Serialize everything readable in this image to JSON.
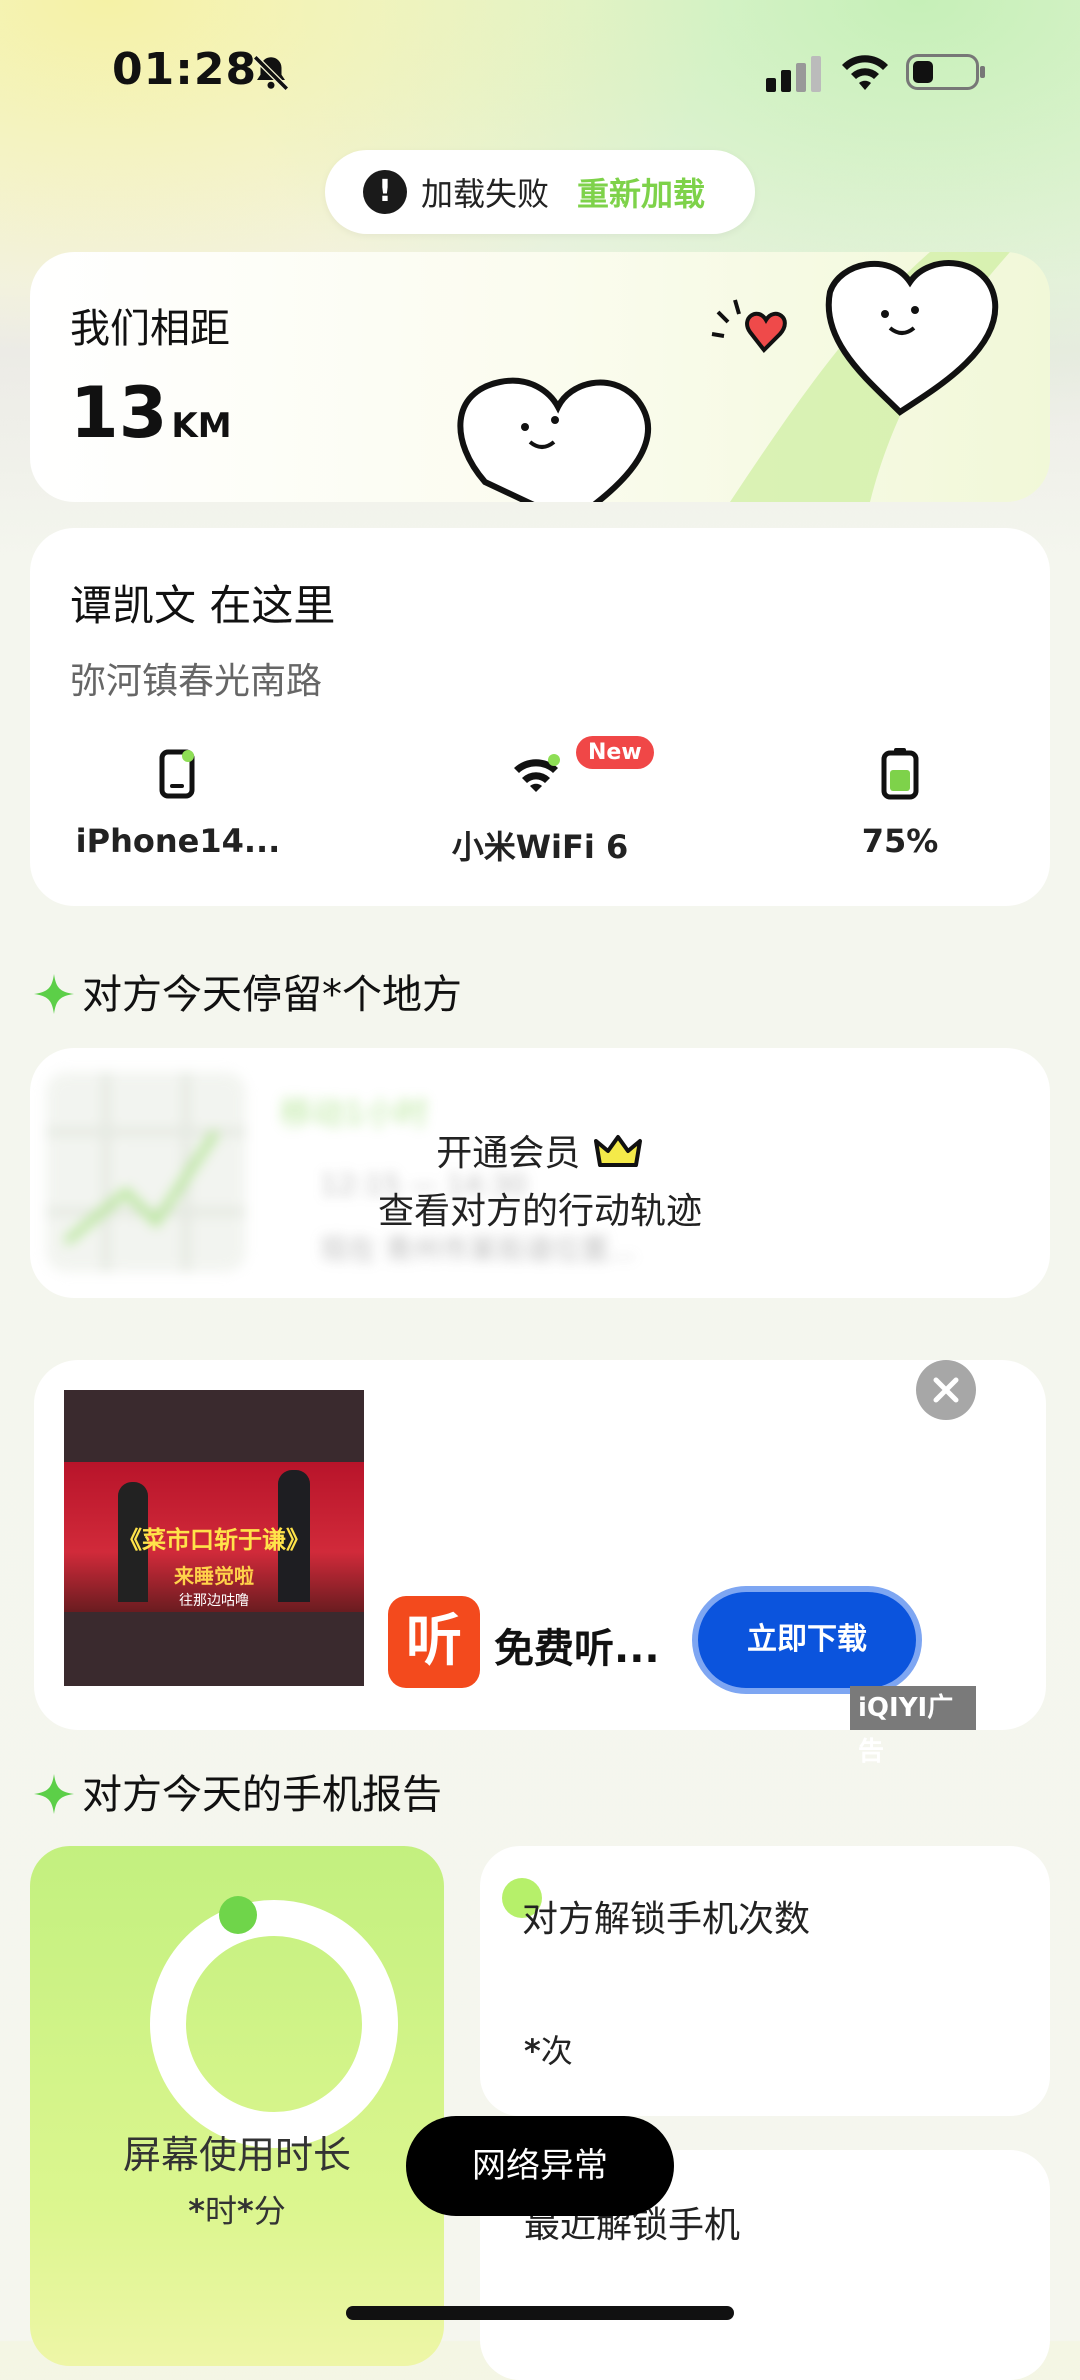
{
  "status_bar": {
    "time": "01:28"
  },
  "load_notice": {
    "message": "加载失败",
    "action": "重新加载"
  },
  "distance": {
    "title": "我们相距",
    "value": "13",
    "unit": "KM"
  },
  "location": {
    "person": "谭凯文 在这里",
    "address": "弥河镇春光南路",
    "device": "iPhone14...",
    "wifi": "小米WiFi 6",
    "wifi_badge": "New",
    "battery": "75%"
  },
  "stay_section": {
    "title": "对方今天停留*个地方"
  },
  "membership": {
    "line1": "开通会员",
    "line2": "查看对方的行动轨迹",
    "blur_title": "移动1小时",
    "blur_row1": "12:15 — 14:30",
    "blur_row2": "现在    青州市某街道位置..."
  },
  "ad": {
    "thumb_title": "《菜市口斩于谦》",
    "thumb_sub": "来睡觉啦",
    "thumb_caption": "往那边咕噜",
    "app_logo": "听",
    "text": "免费听...",
    "button": "立即下载",
    "mark": "iQIYI广告"
  },
  "report_section": {
    "title": "对方今天的手机报告"
  },
  "screen_time": {
    "label": "屏幕使用时长",
    "h_value": "*",
    "h_unit": "时",
    "m_value": "*",
    "m_unit": "分"
  },
  "unlock": {
    "title": "对方解锁手机次数",
    "value": "*",
    "unit": "次"
  },
  "recent_unlock": {
    "title": "最近解锁手机"
  },
  "toast": "网络异常",
  "colors": {
    "accent_green": "#7ed24a",
    "ad_button": "#0b54dd",
    "badge_red": "#f04747"
  }
}
